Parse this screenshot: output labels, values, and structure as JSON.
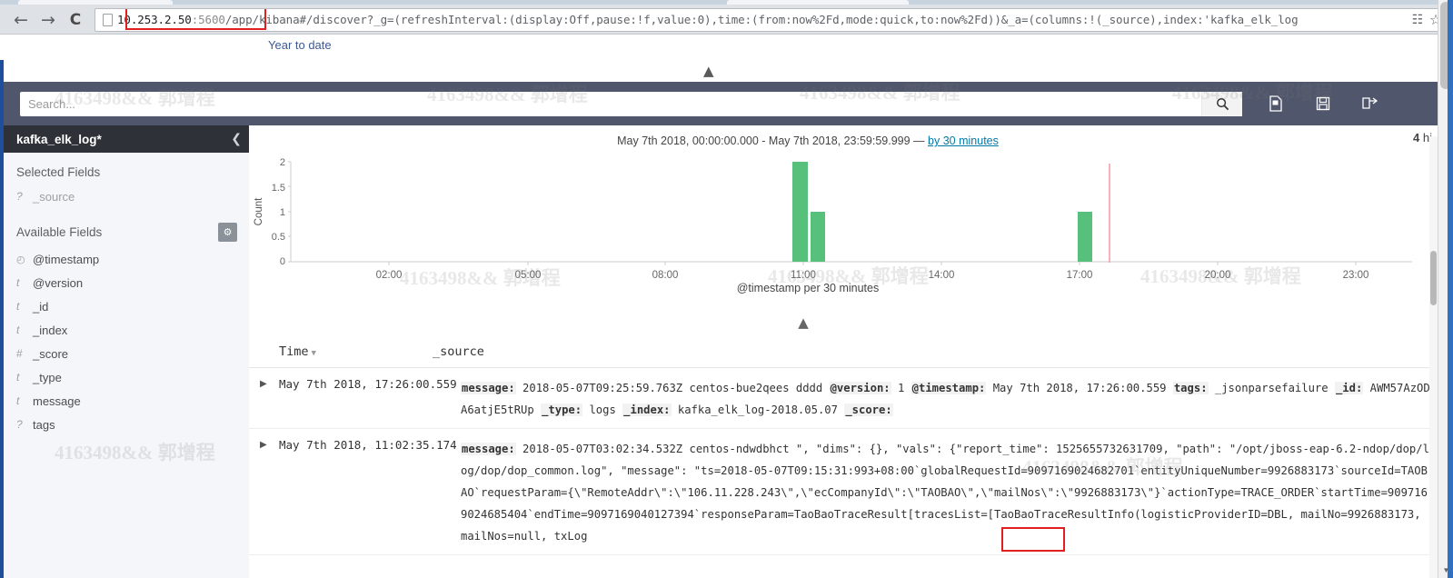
{
  "browser": {
    "back_icon": "back-arrow",
    "forward_icon": "forward-arrow",
    "reload_icon": "reload",
    "url_host": "10.253.2.50",
    "url_port": ":5600",
    "url_rest": "/app/kibana#/discover?_g=(refreshInterval:(display:Off,pause:!f,value:0),time:(from:now%2Fd,mode:quick,to:now%2Fd))&_a=(columns:!(_source),index:'kafka_elk_log",
    "bookmark_label": "Year to date",
    "cast_icon": "cast-icon",
    "star_icon": "star-icon"
  },
  "query": {
    "placeholder": "Search...",
    "value": "",
    "submit_icon": "search-icon",
    "new_label": "new-search-icon",
    "save_label": "save-search-icon",
    "open_label": "open-search-icon"
  },
  "sidebar": {
    "index_pattern": "kafka_elk_log*",
    "collapse_icon": "chevron-left-icon",
    "selected_title": "Selected Fields",
    "available_title": "Available Fields",
    "settings_icon": "gear-icon",
    "selected_fields": [
      {
        "type": "?",
        "name": "_source"
      }
    ],
    "available_fields": [
      {
        "type": "◴",
        "name": "@timestamp"
      },
      {
        "type": "t",
        "name": "@version"
      },
      {
        "type": "t",
        "name": "_id"
      },
      {
        "type": "t",
        "name": "_index"
      },
      {
        "type": "#",
        "name": "_score"
      },
      {
        "type": "t",
        "name": "_type"
      },
      {
        "type": "t",
        "name": "message"
      },
      {
        "type": "?",
        "name": "tags"
      }
    ]
  },
  "results": {
    "hits_count": "4",
    "hits_label": "hi",
    "collapse_chart_icon": "chevron-up-icon",
    "toggle_top_icon": "chevron-up-icon"
  },
  "chart_data": {
    "type": "bar",
    "title": "May 7th 2018, 00:00:00.000 - May 7th 2018, 23:59:59.999 — by 30 minutes",
    "title_prefix": "May 7th 2018, 00:00:00.000 - May 7th 2018, 23:59:59.999 — ",
    "interval_link": "by 30 minutes",
    "xlabel": "@timestamp per 30 minutes",
    "ylabel": "Count",
    "ylim": [
      0,
      2
    ],
    "yticks": [
      "0",
      "0.5",
      "1",
      "1.5",
      "2"
    ],
    "xticks": [
      "02:00",
      "05:00",
      "08:00",
      "11:00",
      "14:00",
      "17:00",
      "20:00",
      "23:00"
    ],
    "bar_color": "#57c17b",
    "marker_color": "#f4a0a8",
    "grid": false,
    "legend": "none",
    "categories": [
      "10:30",
      "11:00",
      "17:00"
    ],
    "values": [
      2,
      1,
      1
    ],
    "marker_time": "17:30"
  },
  "doc_table": {
    "columns": [
      "Time",
      "_source"
    ],
    "sort_icon": "sort-caret-down-icon",
    "rows": [
      {
        "expand_icon": "expand-row-icon",
        "time": "May 7th 2018, 17:26:00.559",
        "source": [
          {
            "k": "message:",
            "v": "2018-05-07T09:25:59.763Z centos-bue2qees dddd"
          },
          {
            "k": "@version:",
            "v": "1"
          },
          {
            "k": "@timestamp:",
            "v": "May 7th 2018, 17:26:00.559"
          },
          {
            "k": "tags:",
            "v": "_jsonparsefailure"
          },
          {
            "k": "_id:",
            "v": "AWM57AzODA6atjE5tRUp"
          },
          {
            "k": "_type:",
            "v": "logs"
          },
          {
            "k": "_index:",
            "v": "kafka_elk_log-2018.05.07"
          },
          {
            "k": "_score:",
            "v": ""
          }
        ]
      },
      {
        "expand_icon": "expand-row-icon",
        "time": "May 7th 2018, 11:02:35.174",
        "source": [
          {
            "k": "message:",
            "v": "2018-05-07T03:02:34.532Z centos-ndwdbhct \", \"dims\": {}, \"vals\": {\"report_time\": 1525655732631709, \"path\": \"/opt/jboss-eap-6.2-ndop/dop/log/dop/dop_common.log\", \"message\": \"ts=2018-05-07T09:15:31:993+08:00`globalRequestId=9097169024682701`entityUniqueNumber=9926883173`sourceId=TAOBAO`requestParam={\\\"RemoteAddr\\\":\\\"106.11.228.243\\\",\\\"ecCompanyId\\\":\\\"TAOBAO\\\",\\\"mailNos\\\":\\\"9926883173\\\"}`actionType=TRACE_ORDER`startTime=9097169024685404`endTime=9097169040127394`responseParam=TaoBaoTraceResult[tracesList=[TaoBaoTraceResultInfo(logisticProviderID=DBL, mailNo=9926883173, mailNos=null, txLog"
          }
        ]
      }
    ]
  },
  "watermark": {
    "text": "4163498&& 郭增程"
  }
}
